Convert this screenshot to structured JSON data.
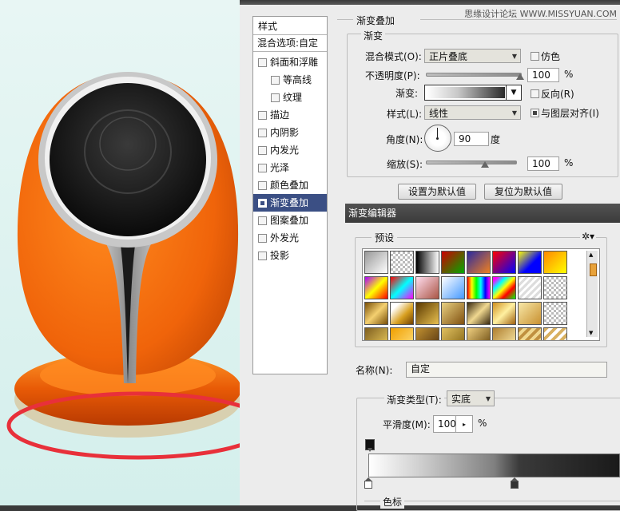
{
  "watermark": "思缘设计论坛 WWW.MISSYUAN.COM",
  "style_list": {
    "title": "样式",
    "blend_options": "混合选项:自定",
    "items": [
      {
        "label": "斜面和浮雕",
        "checked": false,
        "indent": false
      },
      {
        "label": "等高线",
        "checked": false,
        "indent": true
      },
      {
        "label": "纹理",
        "checked": false,
        "indent": true
      },
      {
        "label": "描边",
        "checked": false,
        "indent": false
      },
      {
        "label": "内阴影",
        "checked": false,
        "indent": false
      },
      {
        "label": "内发光",
        "checked": false,
        "indent": false
      },
      {
        "label": "光泽",
        "checked": false,
        "indent": false
      },
      {
        "label": "颜色叠加",
        "checked": false,
        "indent": false
      },
      {
        "label": "渐变叠加",
        "checked": true,
        "indent": false,
        "selected": true
      },
      {
        "label": "图案叠加",
        "checked": false,
        "indent": false
      },
      {
        "label": "外发光",
        "checked": false,
        "indent": false
      },
      {
        "label": "投影",
        "checked": false,
        "indent": false
      }
    ]
  },
  "gradient_overlay": {
    "section_title": "渐变叠加",
    "group_title": "渐变",
    "blend_mode_label": "混合模式(O):",
    "blend_mode_value": "正片叠底",
    "dither_label": "仿色",
    "opacity_label": "不透明度(P):",
    "opacity_value": "100",
    "opacity_unit": "%",
    "opacity_fraction": 1.0,
    "gradient_label": "渐变:",
    "reverse_label": "反向(R)",
    "style_label": "样式(L):",
    "style_value": "线性",
    "align_label": "与图层对齐(I)",
    "align_checked": true,
    "angle_label": "角度(N):",
    "angle_value": "90",
    "angle_unit": "度",
    "scale_label": "缩放(S):",
    "scale_value": "100",
    "scale_unit": "%",
    "scale_fraction": 0.66,
    "make_default": "设置为默认值",
    "reset_default": "复位为默认值"
  },
  "gradient_editor": {
    "title": "渐变编辑器",
    "presets_label": "预设",
    "name_label": "名称(N):",
    "name_value": "自定",
    "type_label": "渐变类型(T):",
    "type_value": "实底",
    "smooth_label": "平滑度(M):",
    "smooth_value": "100",
    "smooth_unit": "%",
    "stops_label": "色标"
  },
  "colors": {
    "accent_selected": "#3b4f84",
    "speaker_orange": "#f06a0a",
    "highlight_circle": "#e8303a"
  }
}
